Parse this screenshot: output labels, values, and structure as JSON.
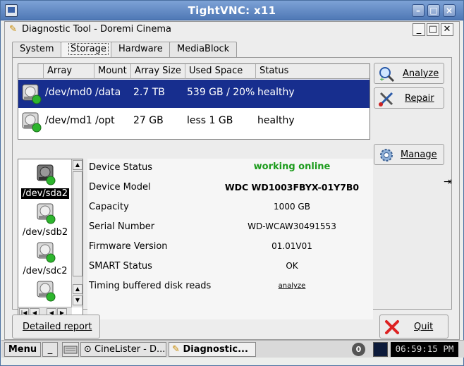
{
  "vnc": {
    "title": "TightVNC: x11"
  },
  "app": {
    "title": "Diagnostic Tool - Doremi Cinema"
  },
  "tabs": [
    "System",
    "Storage",
    "Hardware",
    "MediaBlock"
  ],
  "array_table": {
    "columns": [
      "Array",
      "Mount",
      "Array Size",
      "Used Space",
      "Status"
    ],
    "rows": [
      {
        "device": "/dev/md0",
        "mount": "/data",
        "size": "2.7 TB",
        "used": "539 GB / 20%",
        "status": "healthy"
      },
      {
        "device": "/dev/md1",
        "mount": "/opt",
        "size": "27 GB",
        "used": "less 1 GB",
        "status": "healthy"
      }
    ]
  },
  "buttons": {
    "analyze": "Analyze",
    "repair": "Repair",
    "manage": "Manage",
    "detailed_report": "Detailed report",
    "quit": "Quit"
  },
  "drives": [
    "/dev/sda2",
    "/dev/sdb2",
    "/dev/sdc2"
  ],
  "details": [
    {
      "label": "Device Status",
      "value": "working online"
    },
    {
      "label": "Device Model",
      "value": "WDC WD1003FBYX-01Y7B0"
    },
    {
      "label": "Capacity",
      "value": "1000 GB"
    },
    {
      "label": "Serial Number",
      "value": "WD-WCAW30491553"
    },
    {
      "label": "Firmware Version",
      "value": "01.01V01"
    },
    {
      "label": "SMART Status",
      "value": "OK"
    },
    {
      "label": "Timing buffered disk reads",
      "value": "analyze"
    }
  ],
  "taskbar": {
    "menu": "Menu",
    "minimize": "_",
    "items": [
      "CineLister - D...",
      "Diagnostic..."
    ],
    "badge": "0",
    "clock": "06:59:15 PM"
  },
  "colors": {
    "selection": "#172e8e",
    "status_green": "#1c9b1c",
    "title_blue": "#4f78b5"
  }
}
